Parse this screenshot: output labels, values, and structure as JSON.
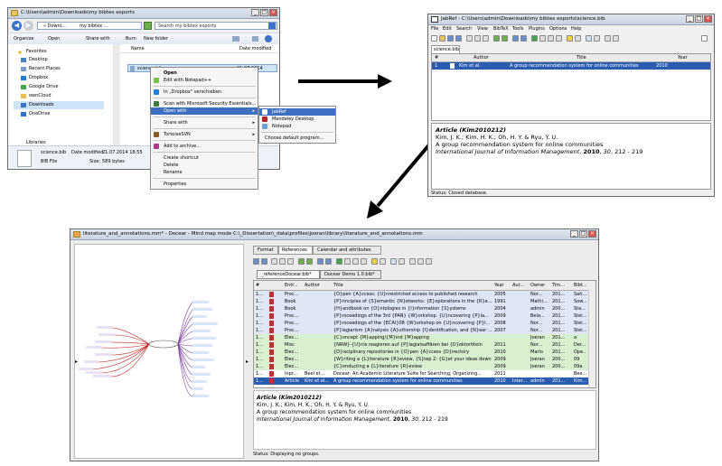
{
  "explorer": {
    "title": "C:\\Users\\admin\\Downloads\\my bibtex exports",
    "address": [
      "« Downl...",
      "my bibtex ..."
    ],
    "search_placeholder": "Search my bibtex exports",
    "toolbar": [
      "Organize",
      "Open",
      "Share with",
      "Burn",
      "New folder"
    ],
    "nav": {
      "favorites": "Favorites",
      "items": [
        "Desktop",
        "Recent Places",
        "Dropbox",
        "Google Drive",
        "ownCloud",
        "Downloads",
        "OneDrive"
      ],
      "libraries": "Libraries"
    },
    "columns": {
      "name": "Name",
      "date": "Date modified"
    },
    "file": {
      "name": "science.bib",
      "date": "21.07.2014 18:55"
    },
    "details": {
      "name": "science.bib",
      "date_label": "Date modified:",
      "date": "21.07.2014 18:55",
      "type": "BIB File",
      "size_label": "Size:",
      "size": "589 bytes"
    },
    "context_menu": [
      "Open",
      "Edit with Notepad++",
      "In „Dropbox\" verschieben",
      "Scan with Microsoft Security Essentials...",
      "Open with",
      "Share with",
      "TortoiseSVN",
      "Add to archive...",
      "Create shortcut",
      "Delete",
      "Rename",
      "Properties"
    ],
    "open_with": [
      "JabRef",
      "Mendeley Desktop",
      "Notepad",
      "Choose default program..."
    ]
  },
  "jabref": {
    "title": "JabRef - C:\\Users\\admin\\Downloads\\my bibtex exports\\science.bib",
    "menu": [
      "File",
      "Edit",
      "Search",
      "View",
      "BibTeX",
      "Tools",
      "Plugins",
      "Options",
      "Help"
    ],
    "tab": "science.bib",
    "columns": [
      "#",
      "",
      "Author",
      "Title",
      "Year"
    ],
    "row": {
      "num": "1",
      "author": "Kim et al.",
      "title": "A group recommendation system for online communities",
      "year": "2010"
    },
    "preview": {
      "heading": "Article (Kim2010212)",
      "authors": "Kim, J. K.; Kim, H. K.; Oh, H. Y. & Ryu, Y. U.",
      "title": "A group recommendation system for online communities",
      "journal": "International Journal of Information Management",
      "sep1": ", ",
      "year": "2010",
      "sep2": ", ",
      "vol": "30",
      "pages": ", 212 - 219"
    },
    "status": "Status: Closed database."
  },
  "docear": {
    "title": "literature_and_annotations.mm* - Docear - Mind map mode C:\\_Dissertation\\_data\\profiles\\joeran\\library\\literature_and_annotations.mm",
    "panel_tabs": [
      "Format",
      "References",
      "Calendar and attributes"
    ],
    "db_tabs": [
      "_referenceDocear.bib*",
      "Docear Demo 1.0.bib*"
    ],
    "columns": [
      "#",
      "Entr...",
      "Author",
      "Title",
      "Year",
      "Aut...",
      "Owner",
      "Tim...",
      "Bibt..."
    ],
    "rows": [
      {
        "n": "1...",
        "e": "Proc...",
        "a": "",
        "t": "{O}pen {A}ccess: {U}nrestricted access to published research",
        "y": "2005",
        "au": "",
        "o": "Nor...",
        "tm": "201...",
        "b": "Sah..."
      },
      {
        "n": "1...",
        "e": "Book",
        "a": "",
        "t": "{P}rinciples of {S}emantic {N}etworks: {E}xplorations in the {R}e...",
        "y": "1991",
        "au": "",
        "o": "Mathi...",
        "tm": "201...",
        "b": "Sow..."
      },
      {
        "n": "1...",
        "e": "Book",
        "a": "",
        "t": "{H}andbook on {O}ntologies in {I}nformation {S}ystems",
        "y": "2004",
        "au": "",
        "o": "admin",
        "tm": "200...",
        "b": "Sta..."
      },
      {
        "n": "1...",
        "e": "Proc...",
        "a": "",
        "t": "{P}roceedings of the 3rd {PAN} {W}orkshop. {U}ncovering {P}la...",
        "y": "2009",
        "au": "",
        "o": "Bela...",
        "tm": "201...",
        "b": "Stei..."
      },
      {
        "n": "1...",
        "e": "Proc...",
        "a": "",
        "t": "{P}roceedings of the {ECAI}08 {W}orkshop on {U}ncovering {P}l...",
        "y": "2008",
        "au": "",
        "o": "Nor...",
        "tm": "201...",
        "b": "Stei..."
      },
      {
        "n": "1...",
        "e": "Proc...",
        "a": "",
        "t": "{P}lagiarism {A}nalysis {A}uthorship {I}dentification, and {N}ear ...",
        "y": "2007",
        "au": "",
        "o": "Nor...",
        "tm": "201...",
        "b": "Stei..."
      },
      {
        "n": "1...",
        "e": "Elec...",
        "a": "",
        "t": "{C}oncept {M}apping/{M}ind {M}apping",
        "y": "",
        "au": "",
        "o": "Joeran",
        "tm": "201...",
        "b": "a"
      },
      {
        "n": "1...",
        "e": "Misc",
        "a": "",
        "t": "{NRW}-{U}nis reagieren auf {P}lagiatsaffären bei {D}oktortiteln",
        "y": "2011",
        "au": "",
        "o": "Nor...",
        "tm": "201...",
        "b": "Der..."
      },
      {
        "n": "1...",
        "e": "Elec...",
        "a": "",
        "t": "{D}isciplinary repositories in {O}pen {A}ccess {D}irectory",
        "y": "2010",
        "au": "",
        "o": "Mario",
        "tm": "201...",
        "b": "Ope..."
      },
      {
        "n": "1...",
        "e": "Elec...",
        "a": "",
        "t": "{W}riting a {L}iterature {R}eview, {S}tep 2: {G}et your ideas down",
        "y": "2009",
        "au": "",
        "o": "Joeran",
        "tm": "200...",
        "b": "09"
      },
      {
        "n": "1...",
        "e": "Elec...",
        "a": "",
        "t": "{C}onducting a {L}iterature {R}eview",
        "y": "2009",
        "au": "",
        "o": "Joeran",
        "tm": "200...",
        "b": "09a"
      },
      {
        "n": "1...",
        "e": "Inpr...",
        "a": "Beel et...",
        "t": "Docear: An Academic Literature Suite for Searching, Organizing...",
        "y": "2011",
        "au": "",
        "o": "",
        "tm": "",
        "b": "Bee..."
      },
      {
        "n": "1...",
        "e": "Article",
        "a": "Kim et al...",
        "t": "A group recommendation system for online communities",
        "y": "2010",
        "au": "Inter...",
        "o": "admin",
        "tm": "201...",
        "b": "Kim..."
      }
    ],
    "preview": {
      "heading": "Article (Kim2010212)",
      "authors": "Kim, J. K.; Kim, H. K.; Oh, H. Y. & Ryu, Y. U.",
      "title": "A group recommendation system for online communities",
      "journal": "International Journal of Information Management",
      "sep1": ", ",
      "year": "2010",
      "sep2": ", ",
      "vol": "30",
      "pages": ", 212 - 219"
    },
    "status": "Status: Displaying no groups."
  },
  "colors": {
    "highlight": "#3d6fc2",
    "green_row": "#d8f0d0",
    "blue_row": "#dfe7f7",
    "selected_row": "#2a5db0"
  }
}
